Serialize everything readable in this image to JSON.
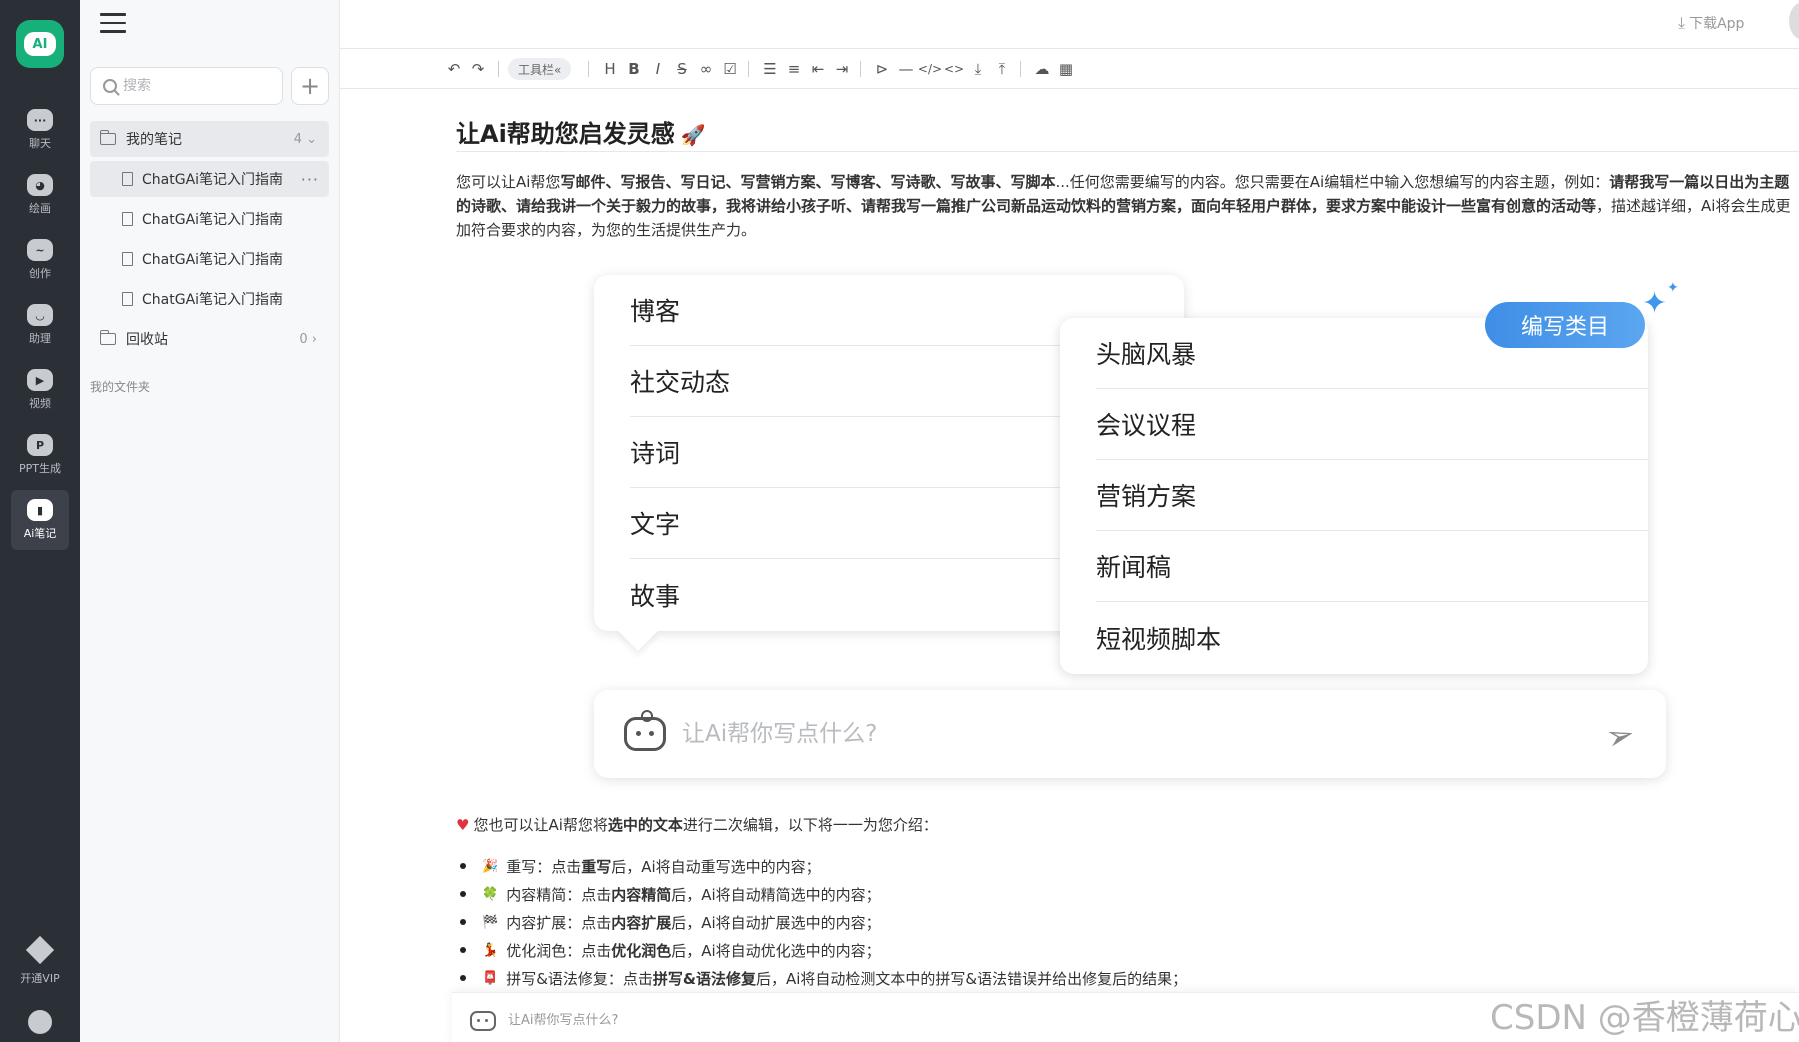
{
  "rail": {
    "logo_text": "AI",
    "items": [
      {
        "label": "聊天",
        "icon": "chat-icon",
        "active": false
      },
      {
        "label": "绘画",
        "icon": "palette-icon",
        "active": false
      },
      {
        "label": "创作",
        "icon": "creation-icon",
        "active": false
      },
      {
        "label": "助理",
        "icon": "assistant-icon",
        "active": false
      },
      {
        "label": "视频",
        "icon": "video-icon",
        "active": false
      },
      {
        "label": "PPT生成",
        "icon": "ppt-icon",
        "active": false
      },
      {
        "label": "Ai笔记",
        "icon": "notebook-icon",
        "active": true
      }
    ],
    "vip_label": "开通VIP"
  },
  "notes": {
    "search_placeholder": "搜索",
    "add_label": "+",
    "my_notes": {
      "label": "我的笔记",
      "count": "4"
    },
    "files": [
      {
        "label": "ChatGAi笔记入门指南"
      },
      {
        "label": "ChatGAi笔记入门指南"
      },
      {
        "label": "ChatGAi笔记入门指南"
      },
      {
        "label": "ChatGAi笔记入门指南"
      }
    ],
    "more_label": "···",
    "trash": {
      "label": "回收站",
      "count": "0"
    },
    "my_folders": "我的文件夹"
  },
  "topbar": {
    "download_label": "下载App"
  },
  "toolbar": {
    "chip_label": "工具栏«"
  },
  "document": {
    "title": "让Ai帮助您启发灵感",
    "intro_a": "您可以让Ai帮您",
    "intro_b": "写邮件、写报告、写日记、写营销方案、写博客、写诗歌、写故事、写脚本",
    "intro_c": "...任何您需要编写的内容。您只需要在Ai编辑栏中输入您想编写的内容主题，例如：",
    "intro_d": "请帮我写一篇以日出为主题的诗歌、请给我讲一个关于毅力的故事，我将讲给小孩子听、请帮我写一篇推广公司新品运动饮料的营销方案，面向年轻用户群体，要求方案中能设计一些富有创意的活动等",
    "intro_e": "，描述越详细，Ai将会生成更加符合要求的内容，为您的生活提供生产力。"
  },
  "card_left": [
    "博客",
    "社交动态",
    "诗词",
    "文字",
    "故事"
  ],
  "card_right": [
    "头脑风暴",
    "会议议程",
    "营销方案",
    "新闻稿",
    "短视频脚本"
  ],
  "badge_label": "编写类目",
  "prompt_placeholder": "让Ai帮你写点什么?",
  "features": {
    "intro_a": "您也可以让Ai帮您将",
    "intro_b": "选中的文本",
    "intro_c": "进行二次编辑，以下将一一为您介绍：",
    "items": [
      {
        "emoji": "🎉",
        "a": "重写：点击",
        "b": "重写",
        "c": "后，Ai将自动重写选中的内容；"
      },
      {
        "emoji": "🍀",
        "a": "内容精简：点击",
        "b": "内容精简",
        "c": "后，Ai将自动精简选中的内容；"
      },
      {
        "emoji": "🏁",
        "a": "内容扩展：点击",
        "b": "内容扩展",
        "c": "后，Ai将自动扩展选中的内容；"
      },
      {
        "emoji": "💃",
        "a": "优化润色：点击",
        "b": "优化润色",
        "c": "后，Ai将自动优化选中的内容；"
      },
      {
        "emoji": "📮",
        "a": "拼写&语法修复：点击",
        "b": "拼写&语法修复",
        "c": "后，Ai将自动检测文本中的拼写&语法错误并给出修复后的结果；"
      }
    ]
  },
  "bottom_prompt_placeholder": "让Ai帮你写点什么?",
  "watermark": "CSDN @香橙薄荷心",
  "colors": {
    "accent": "#18b07a",
    "badge": "#4a98ec",
    "rail": "#2b2f36"
  }
}
